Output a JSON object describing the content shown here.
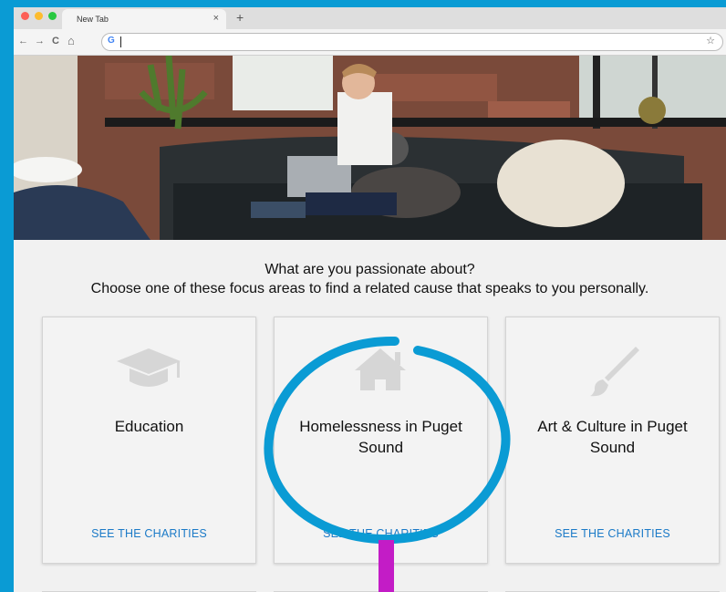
{
  "browser": {
    "tab_title": "New Tab",
    "tab_close": "×",
    "new_tab": "+",
    "omnibox_value": "",
    "omnibox_icon": "G",
    "back": "←",
    "forward": "→",
    "reload": "C",
    "home": "⌂",
    "bookmark": "☆"
  },
  "intro": {
    "line1": "What are you passionate about?",
    "line2": "Choose one of these focus areas to find a related cause that speaks to you personally."
  },
  "cards": [
    {
      "title": "Education",
      "link": "SEE THE CHARITIES",
      "icon": "graduation-cap-icon"
    },
    {
      "title": "Homelessness in Puget Sound",
      "link": "SEE THE CHARITIES",
      "icon": "house-icon"
    },
    {
      "title": "Art & Culture in Puget Sound",
      "link": "SEE THE CHARITIES",
      "icon": "paintbrush-icon"
    }
  ],
  "colors": {
    "background": "#0a9bd4",
    "link": "#1b7ac7",
    "annotation_circle": "#0a9bd4",
    "annotation_bar": "#c31cc6"
  }
}
